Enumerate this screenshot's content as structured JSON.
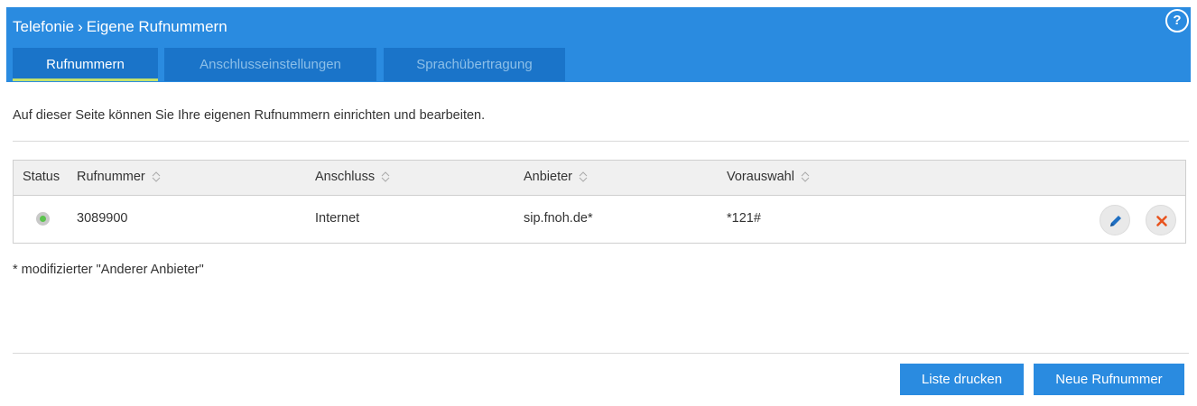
{
  "header": {
    "breadcrumb_parent": "Telefonie",
    "breadcrumb_current": "Eigene Rufnummern",
    "help_label": "?"
  },
  "tabs": [
    {
      "label": "Rufnummern",
      "active": true
    },
    {
      "label": "Anschlusseinstellungen",
      "active": false
    },
    {
      "label": "Sprachübertragung",
      "active": false
    }
  ],
  "intro": "Auf dieser Seite können Sie Ihre eigenen Rufnummern einrichten und bearbeiten.",
  "table": {
    "columns": [
      "Status",
      "Rufnummer",
      "Anschluss",
      "Anbieter",
      "Vorauswahl"
    ],
    "rows": [
      {
        "status": "active",
        "rufnummer": "3089900",
        "anschluss": "Internet",
        "anbieter": "sip.fnoh.de*",
        "vorauswahl": "*121#"
      }
    ]
  },
  "footnote": "* modifizierter \"Anderer Anbieter\"",
  "buttons": {
    "print": "Liste drucken",
    "new": "Neue Rufnummer"
  },
  "colors": {
    "header_bg": "#2a8be0",
    "tab_bg": "#1a74c9",
    "tab_active_underline": "#c3e16b",
    "edit_icon": "#1f6fc2",
    "delete_icon": "#e8541f",
    "status_on": "#5cc34e"
  },
  "icons": [
    "help-icon",
    "sort-icon",
    "status-led-icon",
    "edit-pencil-icon",
    "delete-x-icon"
  ]
}
